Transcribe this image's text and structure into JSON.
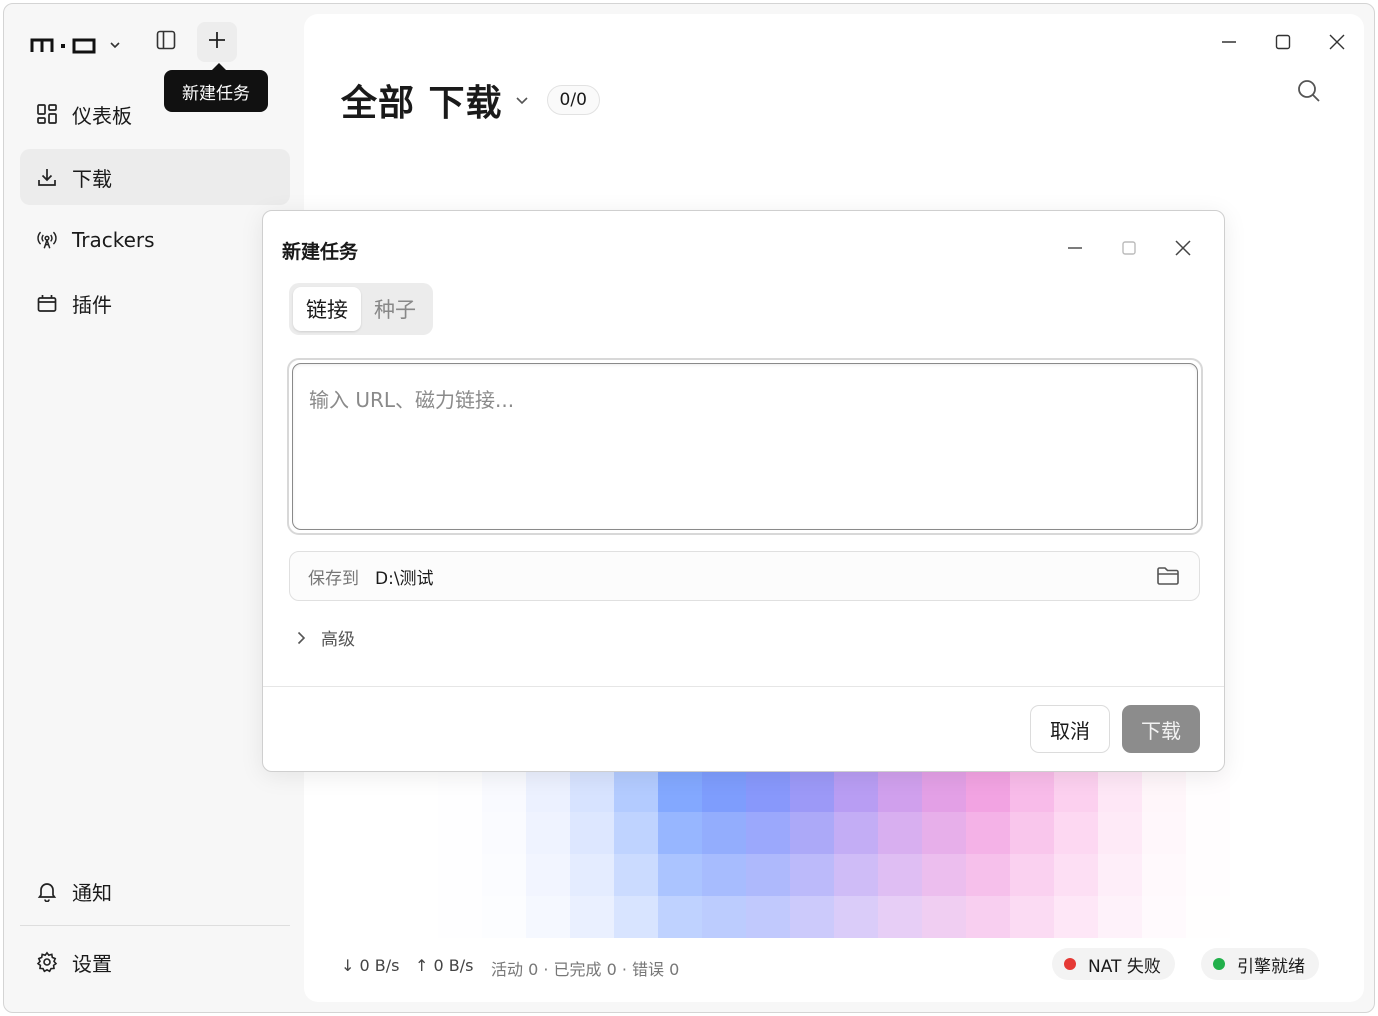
{
  "sidebar": {
    "tooltip": "新建任务",
    "items": [
      {
        "label": "仪表板",
        "icon": "dashboard-icon"
      },
      {
        "label": "下载",
        "icon": "download-icon"
      },
      {
        "label": "Trackers",
        "icon": "broadcast-icon"
      },
      {
        "label": "插件",
        "icon": "plugin-icon"
      }
    ],
    "bottom_items": [
      {
        "label": "通知",
        "icon": "bell-icon"
      },
      {
        "label": "设置",
        "icon": "gear-icon"
      }
    ]
  },
  "main": {
    "title": "全部 下载",
    "count": "0/0"
  },
  "status": {
    "down_speed": "↓ 0 B/s",
    "up_speed": "↑ 0 B/s",
    "summary": "活动 0 · 已完成 0 · 错误 0",
    "nat": "NAT 失败",
    "nat_color": "#e53935",
    "engine": "引擎就绪",
    "engine_color": "#22b04b"
  },
  "dialog": {
    "title": "新建任务",
    "tabs": [
      "链接",
      "种子"
    ],
    "url_placeholder": "输入 URL、磁力链接...",
    "url_value": "",
    "save_label": "保存到",
    "save_path": "D:\\测试",
    "advanced_label": "高级",
    "cancel_label": "取消",
    "download_label": "下载"
  }
}
